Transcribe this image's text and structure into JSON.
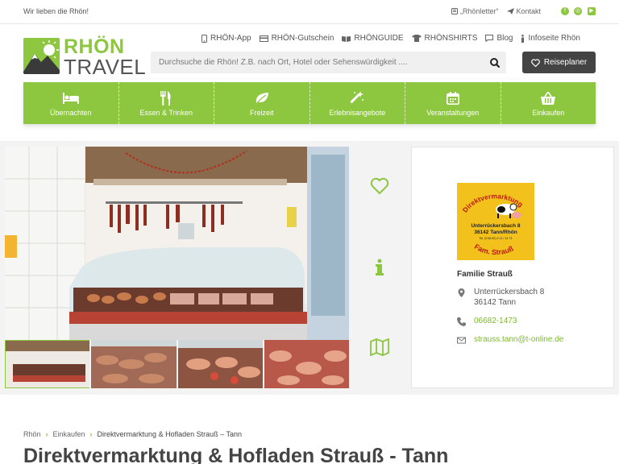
{
  "topbar": {
    "tagline": "Wir lieben die Rhön!",
    "newsletter": "„Rhönletter“",
    "contact": "Kontakt",
    "social": [
      "facebook-icon",
      "instagram-icon",
      "youtube-icon"
    ]
  },
  "logo": {
    "word1": "RHÖN",
    "word2": "TRAVEL"
  },
  "secondary_nav": [
    {
      "label": "RHÖN-App",
      "icon": "phone-icon"
    },
    {
      "label": "RHÖN-Gutschein",
      "icon": "voucher-icon"
    },
    {
      "label": "RHÖNGUIDE",
      "icon": "book-icon"
    },
    {
      "label": "RHÖNSHIRTS",
      "icon": "shirt-icon"
    },
    {
      "label": "Blog",
      "icon": "chat-icon"
    },
    {
      "label": "Infoseite Rhön",
      "icon": "info-icon"
    }
  ],
  "search": {
    "placeholder": "Durchsuche die Rhön! Z.B. nach Ort, Hotel oder Sehenswürdigkeit ...."
  },
  "planner_button": "Reiseplaner",
  "main_nav": [
    {
      "label": "Übernachten",
      "icon": "bed-icon"
    },
    {
      "label": "Essen & Trinken",
      "icon": "cutlery-icon"
    },
    {
      "label": "Freizeit",
      "icon": "leaf-icon"
    },
    {
      "label": "Erlebnisangebote",
      "icon": "magic-wand-icon"
    },
    {
      "label": "Veranstaltungen",
      "icon": "calendar-icon"
    },
    {
      "label": "Einkaufen",
      "icon": "basket-icon"
    }
  ],
  "side_icons": [
    "heart-icon",
    "info-icon",
    "map-icon"
  ],
  "contact_card": {
    "badge_lines": [
      "Direktvermarktung",
      "Unterrückersbach 8",
      "36142 Tann/Rhön",
      "Tel. (0 66 82) 0 11 / 14 73",
      "Fam. Strauß"
    ],
    "owner": "Familie Strauß",
    "street": "Unterrückersbach 8",
    "city": "36142 Tann",
    "phone": "06682-1473",
    "email": "strauss.tann@t-online.de"
  },
  "breadcrumb": [
    "Rhön",
    "Einkaufen",
    "Direktvermarktung & Hofladen Strauß – Tann"
  ],
  "page_title": "Direktvermarktung & Hofladen Strauß - Tann",
  "colors": {
    "accent": "#8dc63f",
    "dark": "#444444",
    "badge": "#f2c11b"
  }
}
